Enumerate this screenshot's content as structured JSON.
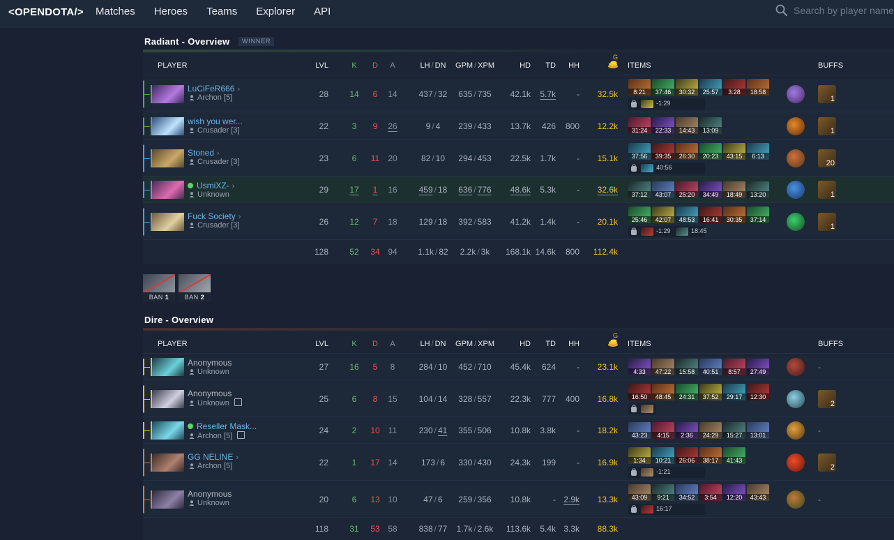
{
  "nav": {
    "logo": "<OPENDOTA/>",
    "links": [
      "Matches",
      "Heroes",
      "Teams",
      "Explorer",
      "API"
    ],
    "search_placeholder": "Search by player name"
  },
  "headers": {
    "player": "PLAYER",
    "lvl": "LVL",
    "k": "K",
    "d": "D",
    "a": "A",
    "lh": "LH",
    "dn": "DN",
    "gpm": "GPM",
    "xpm": "XPM",
    "hd": "HD",
    "td": "TD",
    "hh": "HH",
    "g": "G",
    "items": "ITEMS",
    "buffs": "BUFFS"
  },
  "radiant": {
    "title": "Radiant - Overview",
    "badge": "WINNER",
    "players": [
      {
        "name": "LuCiFeR666",
        "rank": "Archon [5]",
        "lvl": "28",
        "k": "14",
        "d": "6",
        "a": "14",
        "lh": "437",
        "dn": "32",
        "gpm": "635",
        "xpm": "735",
        "hd": "42.1k",
        "td": "5.7k",
        "hh": "-",
        "gold": "32.5k",
        "items": [
          "8:21",
          "37:46",
          "30:32",
          "25:57",
          "3:28",
          "18:58"
        ],
        "backpack": [
          "-1:29"
        ],
        "buff": "1"
      },
      {
        "name": "wish you wer...",
        "rank": "Crusader [3]",
        "lvl": "22",
        "k": "3",
        "d": "9",
        "a": "26",
        "lh": "9",
        "dn": "4",
        "gpm": "239",
        "xpm": "433",
        "hd": "13.7k",
        "td": "426",
        "hh": "800",
        "gold": "12.2k",
        "items": [
          "31:24",
          "22:33",
          "14:43",
          "13:09"
        ],
        "backpack": [],
        "buff": "1"
      },
      {
        "name": "Stoned",
        "rank": "Crusader [3]",
        "lvl": "23",
        "k": "6",
        "d": "11",
        "a": "20",
        "lh": "82",
        "dn": "10",
        "gpm": "294",
        "xpm": "453",
        "hd": "22.5k",
        "td": "1.7k",
        "hh": "-",
        "gold": "15.1k",
        "items": [
          "37:56",
          "39:35",
          "26:30",
          "20:23",
          "43:15",
          "6:13"
        ],
        "backpack": [
          "40:56"
        ],
        "buff": "20"
      },
      {
        "name": "UsmiXZ-",
        "rank": "Unknown",
        "lvl": "29",
        "k": "17",
        "d": "1",
        "a": "16",
        "lh": "459",
        "dn": "18",
        "gpm": "636",
        "xpm": "776",
        "hd": "48.6k",
        "td": "5.3k",
        "hh": "-",
        "gold": "32.6k",
        "items": [
          "37:12",
          "43:07",
          "25:20",
          "34:49",
          "18:49",
          "13:20"
        ],
        "backpack": [],
        "buff": "1"
      },
      {
        "name": "Fuck Society",
        "rank": "Crusader [3]",
        "lvl": "26",
        "k": "12",
        "d": "7",
        "a": "18",
        "lh": "129",
        "dn": "18",
        "gpm": "392",
        "xpm": "583",
        "hd": "41.2k",
        "td": "1.4k",
        "hh": "-",
        "gold": "20.1k",
        "items": [
          "25:46",
          "42:07",
          "48:53",
          "16:41",
          "30:35",
          "37:14"
        ],
        "backpack": [
          "-1:29",
          "18:45"
        ],
        "buff": "1"
      }
    ],
    "totals": {
      "lvl": "128",
      "k": "52",
      "d": "34",
      "a": "94",
      "lh": "1.1k",
      "dn": "82",
      "gpm": "2.2k",
      "xpm": "3k",
      "hd": "168.1k",
      "td": "14.6k",
      "hh": "800",
      "gold": "112.4k"
    }
  },
  "bans": [
    {
      "label": "BAN",
      "num": "1"
    },
    {
      "label": "BAN",
      "num": "2"
    }
  ],
  "dire": {
    "title": "Dire - Overview",
    "players": [
      {
        "name": "Anonymous",
        "rank": "Unknown",
        "lvl": "27",
        "k": "16",
        "d": "5",
        "a": "8",
        "lh": "284",
        "dn": "10",
        "gpm": "452",
        "xpm": "710",
        "hd": "45.4k",
        "td": "624",
        "hh": "-",
        "gold": "23.1k",
        "items": [
          "4:33",
          "47:22",
          "15:58",
          "40:51",
          "8:57",
          "27:49"
        ],
        "backpack": [],
        "buff": "-"
      },
      {
        "name": "Anonymous",
        "rank": "Unknown",
        "lvl": "25",
        "k": "6",
        "d": "8",
        "a": "15",
        "lh": "104",
        "dn": "14",
        "gpm": "328",
        "xpm": "557",
        "hd": "22.3k",
        "td": "777",
        "hh": "400",
        "gold": "16.8k",
        "items": [
          "16:50",
          "48:45",
          "24:31",
          "37:52",
          "29:17",
          "12:30"
        ],
        "backpack": [],
        "buff": "2"
      },
      {
        "name": "Reseller Mask...",
        "rank": "Archon [5]",
        "lvl": "24",
        "k": "2",
        "d": "10",
        "a": "11",
        "lh": "230",
        "dn": "41",
        "gpm": "355",
        "xpm": "506",
        "hd": "10.8k",
        "td": "3.8k",
        "hh": "-",
        "gold": "18.2k",
        "items": [
          "43:23",
          "4:15",
          "2:36",
          "24:29",
          "15:27",
          "13:01"
        ],
        "backpack": [],
        "buff": "-"
      },
      {
        "name": "GG NELINE",
        "rank": "Archon [5]",
        "lvl": "22",
        "k": "1",
        "d": "17",
        "a": "14",
        "lh": "173",
        "dn": "6",
        "gpm": "330",
        "xpm": "430",
        "hd": "24.3k",
        "td": "199",
        "hh": "-",
        "gold": "16.9k",
        "items": [
          "1:34",
          "10:21",
          "26:06",
          "38:17",
          "41:43"
        ],
        "backpack": [
          "-1:21"
        ],
        "buff": "2"
      },
      {
        "name": "Anonymous",
        "rank": "Unknown",
        "lvl": "20",
        "k": "6",
        "d": "13",
        "a": "10",
        "lh": "47",
        "dn": "6",
        "gpm": "259",
        "xpm": "356",
        "hd": "10.8k",
        "td": "-",
        "hh": "2.9k",
        "gold": "13.3k",
        "items": [
          "43:09",
          "9:21",
          "34:52",
          "3:54",
          "12:20",
          "43:43"
        ],
        "backpack": [
          "16:17"
        ],
        "buff": "-"
      }
    ],
    "totals": {
      "lvl": "118",
      "k": "31",
      "d": "53",
      "a": "58",
      "lh": "838",
      "dn": "77",
      "gpm": "1.7k",
      "xpm": "2.6k",
      "hd": "113.6k",
      "td": "5.4k",
      "hh": "3.3k",
      "gold": "88.3k"
    }
  }
}
